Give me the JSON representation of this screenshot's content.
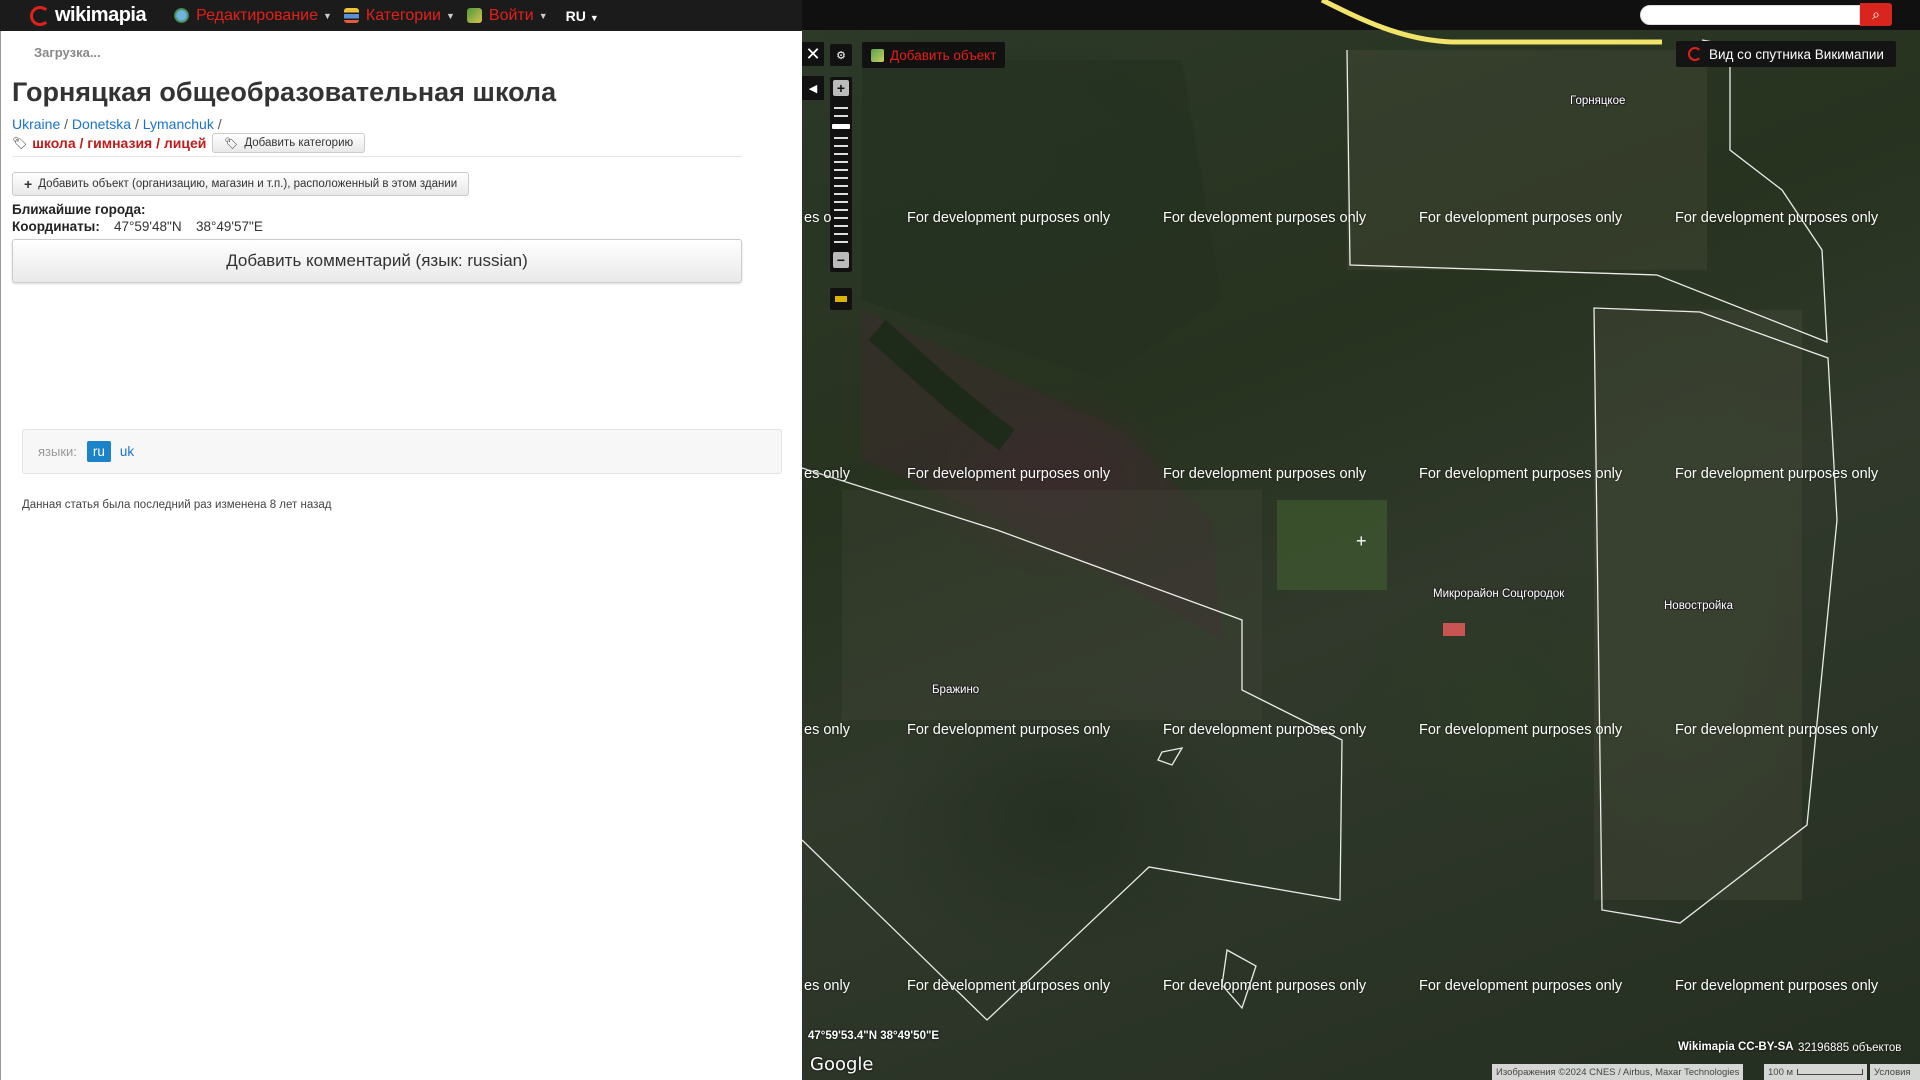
{
  "header": {
    "logo_text": "wikimapia",
    "menu": [
      {
        "label": "Редактирование",
        "icon": "globe-edit-icon"
      },
      {
        "label": "Категории",
        "icon": "categories-icon"
      },
      {
        "label": "Войти",
        "icon": "login-icon"
      }
    ],
    "language": "RU"
  },
  "panel": {
    "loading": "Загрузка...",
    "title": "Горняцкая общеобразовательная школа",
    "breadcrumbs": [
      "Ukraine",
      "Donetska",
      "Lymanchuk"
    ],
    "category_link": "школа / гимназия / лицей",
    "add_category_label": "Добавить категорию",
    "add_object_in_building": "Добавить объект (организацию, магазин и т.п.), расположенный в этом здании",
    "nearest_cities_label": "Ближайшие города:",
    "coordinates_label": "Координаты:",
    "coordinates_lat": "47°59'48\"N",
    "coordinates_lon": "38°49'57\"E",
    "add_comment_label": "Добавить комментарий (язык: russian)",
    "languages_label": "языки:",
    "languages": [
      "ru",
      "uk"
    ],
    "last_modified": "Данная статья была последний раз изменена 8 лет назад"
  },
  "map": {
    "add_object_label": "Добавить объект",
    "satellite_view_label": "Вид со спутника Викимапии",
    "search_placeholder": "",
    "watermark": "For development purposes only",
    "watermark_partial": "es only",
    "watermark_partial_2": "es o",
    "place_labels": [
      "Горняцкое",
      "Микрорайон Соцгородок",
      "Новостройка",
      "Бражино"
    ],
    "coordinate_readout": "47°59'53.4\"N 38°49'50\"E",
    "google_label": "Google",
    "license": "Wikimapia CC-BY-SA",
    "object_count": "32196885 объектов",
    "attribution": "Изображения ©2024 CNES / Airbus, Maxar Technologies",
    "scale_label": "100 м",
    "terms_label": "Условия",
    "colors": {
      "accent_red": "#e4201b",
      "link_blue": "#1a73c9",
      "road_yellow": "#f2e46b",
      "boundary_white": "#ffffff"
    }
  }
}
